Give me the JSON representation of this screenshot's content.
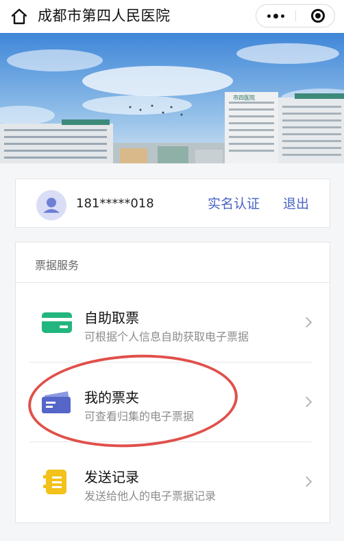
{
  "header": {
    "title": "成都市第四人民医院",
    "icons": {
      "home": "home-icon",
      "more": "more-dots-icon",
      "close": "mini-program-close-icon"
    }
  },
  "banner": {
    "building_sign": "市四医院"
  },
  "user": {
    "phone": "181*****018",
    "verify_label": "实名认证",
    "logout_label": "退出",
    "avatar_icon": "user-avatar-icon"
  },
  "services": {
    "section_title": "票据服务",
    "items": [
      {
        "name": "自助取票",
        "desc": "可根据个人信息自助获取电子票据",
        "icon": "ticket-card-icon",
        "color": "#22b57d"
      },
      {
        "name": "我的票夹",
        "desc": "可查看归集的电子票据",
        "icon": "ticket-folder-icon",
        "color": "#5566c8"
      },
      {
        "name": "发送记录",
        "desc": "发送给他人的电子票据记录",
        "icon": "send-record-icon",
        "color": "#f2c21b"
      }
    ]
  },
  "colors": {
    "link": "#4a63c6",
    "highlight": "#e0504a"
  }
}
